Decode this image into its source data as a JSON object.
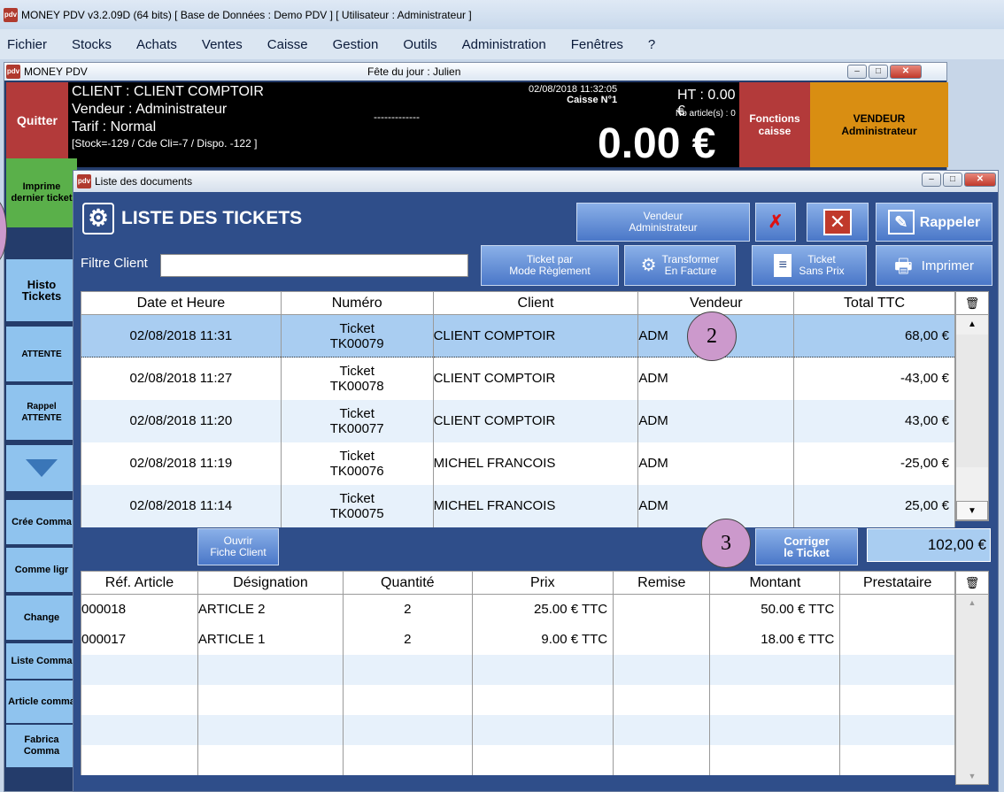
{
  "window": {
    "title": "MONEY PDV v3.2.09D (64 bits) [ Base de Données : Demo PDV ] [ Utilisateur : Administrateur ]"
  },
  "menu": [
    "Fichier",
    "Stocks",
    "Achats",
    "Ventes",
    "Caisse",
    "Gestion",
    "Outils",
    "Administration",
    "Fenêtres",
    "?"
  ],
  "inner": {
    "title": "MONEY PDV",
    "feast": "Fête du jour : Julien"
  },
  "header": {
    "quit": "Quitter",
    "client": "CLIENT : CLIENT COMPTOIR",
    "vendeur": "Vendeur : Administrateur",
    "tarif": "Tarif : Normal",
    "stock": "[Stock=-129 / Cde Cli=-7 / Dispo. -122 ]",
    "dashes": "-------------",
    "datetime": "02/08/2018 11:32:05",
    "caisse": "Caisse N°1",
    "ht": "HT : 0.00 €",
    "nb_articles": "Nb article(s) : 0",
    "total": "0.00 €",
    "fonctions": "Fonctions caisse",
    "vendeur_btn_1": "VENDEUR",
    "vendeur_btn_2": "Administrateur"
  },
  "sidebar": {
    "imprime": "Imprime dernier ticket",
    "histo": "Histo Tickets",
    "attente": "ATTENTE",
    "rappel": "Rappel ATTENTE",
    "cree": "Crée Comma",
    "comme": "Comme ligr",
    "changer": "Change",
    "liste": "Liste Comma",
    "article": "Article comma",
    "fabrica": "Fabrica Comma"
  },
  "dialog": {
    "title": "Liste des documents",
    "heading": "LISTE DES TICKETS",
    "vendeur_btn_1": "Vendeur",
    "vendeur_btn_2": "Administrateur",
    "rappeler": "Rappeler",
    "filter_label": "Filtre Client",
    "filter_value": "",
    "ticket_par_1": "Ticket par",
    "ticket_par_2": "Mode Règlement",
    "transformer_1": "Transformer",
    "transformer_2": "En Facture",
    "sans_prix_1": "Ticket",
    "sans_prix_2": "Sans Prix",
    "imprimer": "Imprimer",
    "ouvrir_1": "Ouvrir",
    "ouvrir_2": "Fiche Client",
    "corriger_1": "Corriger",
    "corriger_2": "le Ticket",
    "total": "102,00 €"
  },
  "tickets": {
    "headers": [
      "Date et Heure",
      "Numéro",
      "Client",
      "Vendeur",
      "Total TTC"
    ],
    "rows": [
      {
        "date": "02/08/2018 11:31",
        "type": "Ticket",
        "num": "TK00079",
        "client": "CLIENT COMPTOIR",
        "vendeur": "ADM",
        "total": "68,00 €"
      },
      {
        "date": "02/08/2018 11:27",
        "type": "Ticket",
        "num": "TK00078",
        "client": "CLIENT COMPTOIR",
        "vendeur": "ADM",
        "total": "-43,00 €"
      },
      {
        "date": "02/08/2018 11:20",
        "type": "Ticket",
        "num": "TK00077",
        "client": "CLIENT COMPTOIR",
        "vendeur": "ADM",
        "total": "43,00 €"
      },
      {
        "date": "02/08/2018 11:19",
        "type": "Ticket",
        "num": "TK00076",
        "client": "MICHEL FRANCOIS",
        "vendeur": "ADM",
        "total": "-25,00 €"
      },
      {
        "date": "02/08/2018 11:14",
        "type": "Ticket",
        "num": "TK00075",
        "client": "MICHEL FRANCOIS",
        "vendeur": "ADM",
        "total": "25,00 €"
      }
    ]
  },
  "lines": {
    "headers": [
      "Réf. Article",
      "Désignation",
      "Quantité",
      "Prix",
      "Remise",
      "Montant",
      "Prestataire"
    ],
    "rows": [
      {
        "ref": "000018",
        "des": "ARTICLE 2",
        "qte": "2",
        "prix": "25.00 € TTC",
        "remise": "",
        "montant": "50.00 € TTC",
        "prest": ""
      },
      {
        "ref": "000017",
        "des": "ARTICLE 1",
        "qte": "2",
        "prix": "9.00 € TTC",
        "remise": "",
        "montant": "18.00 € TTC",
        "prest": ""
      }
    ]
  },
  "annotations": {
    "c2": "2",
    "c3": "3"
  }
}
